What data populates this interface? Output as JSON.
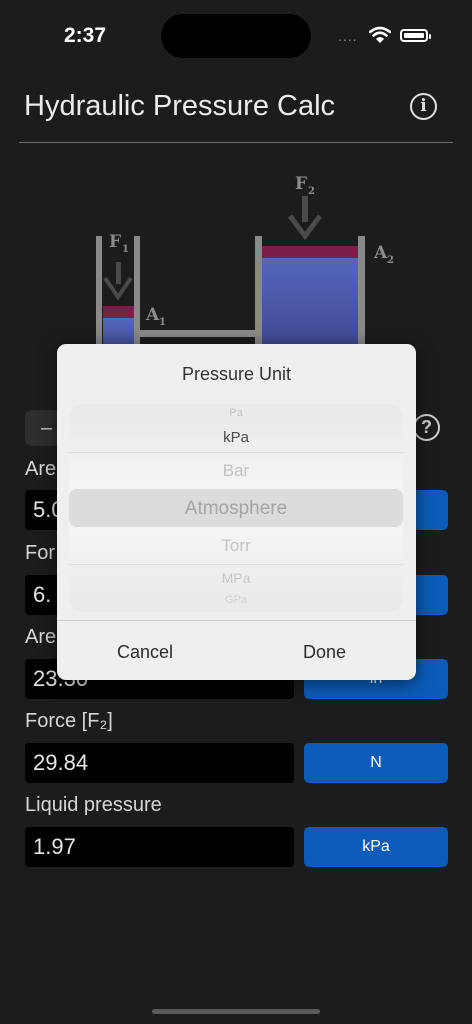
{
  "status": {
    "time": "2:37",
    "signal": "....",
    "wifi_icon": "wifi-icon",
    "battery_icon": "battery-icon"
  },
  "header": {
    "title": "Hydraulic Pressure Calc",
    "info_icon": "info-icon"
  },
  "diagram": {
    "label_f1": "F",
    "label_f1_sub": "1",
    "label_a1": "A",
    "label_a1_sub": "1",
    "label_f2": "F",
    "label_f2_sub": "2",
    "label_a2": "A",
    "label_a2_sub": "2",
    "colors": {
      "liquid": "#4f5fb0",
      "piston": "#7a1f4a",
      "vessel": "#8a8a8a",
      "arrow": "#4a4a4a"
    }
  },
  "controls": {
    "seg_minus": "–",
    "help": "?"
  },
  "form": {
    "area1": {
      "label": "Are",
      "value": "5.0",
      "unit": ""
    },
    "force1": {
      "label": "For",
      "value": "6.",
      "unit": ""
    },
    "area2": {
      "label": "Are",
      "value": "23.30",
      "unit": "in"
    },
    "force2": {
      "label": "Force [F₂]",
      "value": "29.84",
      "unit": "N"
    },
    "pressure": {
      "label": "Liquid pressure",
      "value": "1.97",
      "unit": "kPa"
    },
    "accent": "#0a5cb8"
  },
  "dialog": {
    "title": "Pressure Unit",
    "options": [
      "Pa",
      "kPa",
      "Bar",
      "Atmosphere",
      "Torr",
      "MPa",
      "GPa"
    ],
    "selected": "Atmosphere",
    "cancel": "Cancel",
    "done": "Done"
  }
}
